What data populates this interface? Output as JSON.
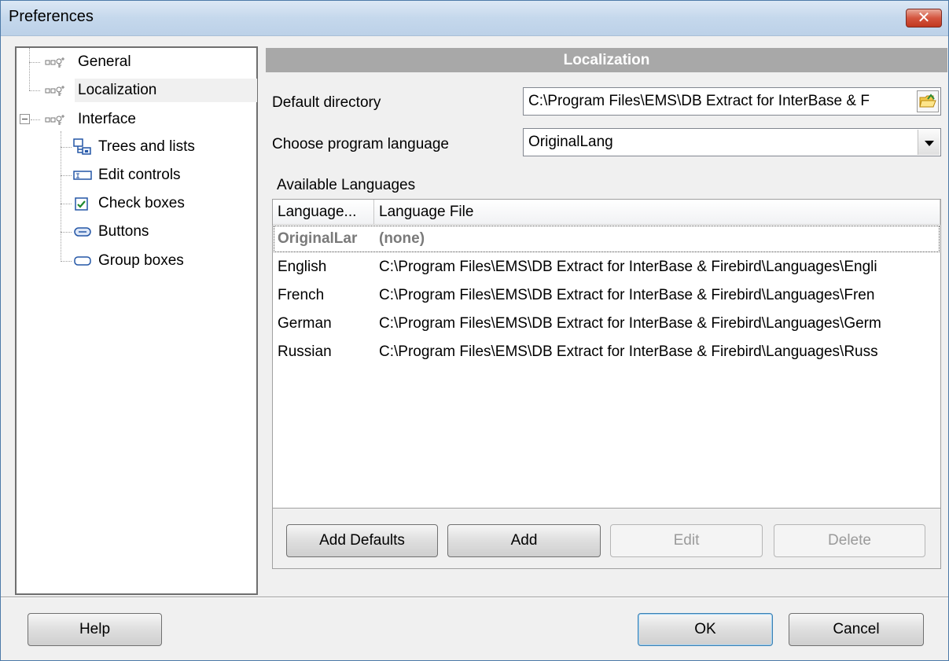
{
  "window": {
    "title": "Preferences",
    "close_symbol": "✕"
  },
  "tree": {
    "items": [
      {
        "label": "General",
        "icon": "gear-key-icon"
      },
      {
        "label": "Localization",
        "icon": "gear-key-icon",
        "selected": true
      },
      {
        "label": "Interface",
        "icon": "gear-key-icon",
        "expanded": true
      },
      {
        "label": "Trees and lists",
        "icon": "tree-view-icon"
      },
      {
        "label": "Edit controls",
        "icon": "edit-control-icon"
      },
      {
        "label": "Check boxes",
        "icon": "checkbox-icon"
      },
      {
        "label": "Buttons",
        "icon": "button-icon"
      },
      {
        "label": "Group boxes",
        "icon": "groupbox-icon"
      }
    ],
    "collapse_symbol": "−"
  },
  "panel": {
    "header": "Localization",
    "default_directory_label": "Default directory",
    "default_directory_value": "C:\\Program Files\\EMS\\DB Extract for InterBase & F",
    "language_label": "Choose program language",
    "language_value": "OriginalLang",
    "available_label": "Available Languages",
    "columns": [
      "Language...",
      "Language File"
    ],
    "rows": [
      {
        "language": "OriginalLar",
        "file": "(none)",
        "selected": true
      },
      {
        "language": "English",
        "file": "C:\\Program Files\\EMS\\DB Extract for InterBase & Firebird\\Languages\\Engli"
      },
      {
        "language": "French",
        "file": "C:\\Program Files\\EMS\\DB Extract for InterBase & Firebird\\Languages\\Fren"
      },
      {
        "language": "German",
        "file": "C:\\Program Files\\EMS\\DB Extract for InterBase & Firebird\\Languages\\Germ"
      },
      {
        "language": "Russian",
        "file": "C:\\Program Files\\EMS\\DB Extract for InterBase & Firebird\\Languages\\Russ"
      }
    ],
    "buttons": {
      "add_defaults": "Add Defaults",
      "add": "Add",
      "edit": "Edit",
      "delete": "Delete"
    }
  },
  "footer": {
    "help": "Help",
    "ok": "OK",
    "cancel": "Cancel"
  }
}
